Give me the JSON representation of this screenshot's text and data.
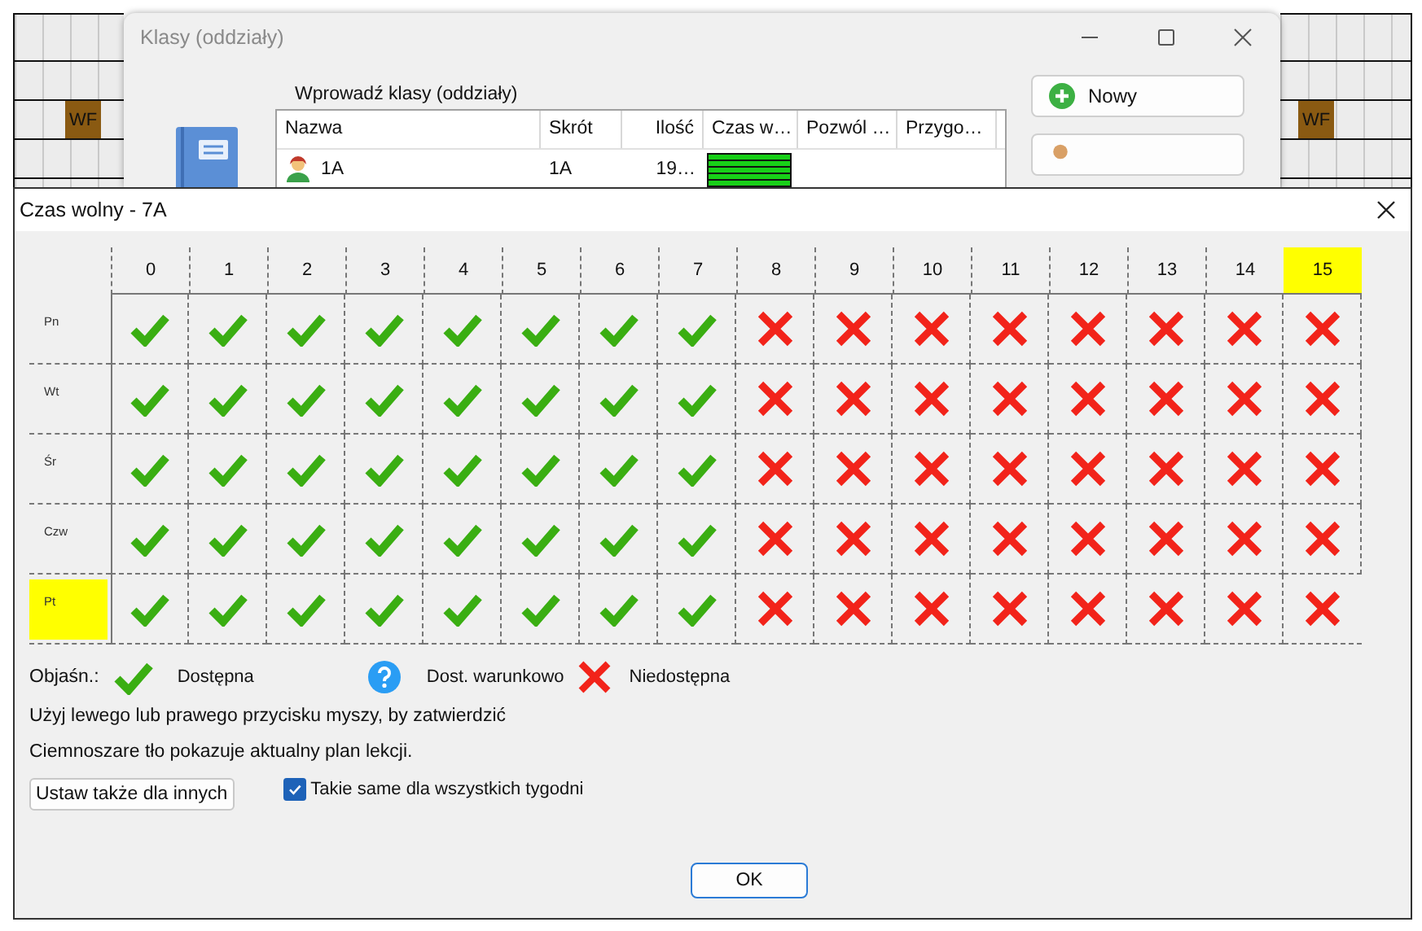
{
  "background_cells": [
    {
      "label": "WF"
    },
    {
      "label": "WF"
    }
  ],
  "class_window": {
    "title": "Klasy (oddziały)",
    "list_label": "Wprowadź klasy (oddziały)",
    "columns": [
      "Nazwa",
      "Skrót",
      "Ilość",
      "Czas w…",
      "Pozwól …",
      "Przygo…"
    ],
    "rows": [
      {
        "name": "1A",
        "short": "1A",
        "count": "19…"
      }
    ],
    "new_button": "Nowy"
  },
  "dialog": {
    "title": "Czas wolny - 7A",
    "hours": [
      {
        "label": "0",
        "selected": false
      },
      {
        "label": "1",
        "selected": false
      },
      {
        "label": "2",
        "selected": false
      },
      {
        "label": "3",
        "selected": false
      },
      {
        "label": "4",
        "selected": false
      },
      {
        "label": "5",
        "selected": false
      },
      {
        "label": "6",
        "selected": false
      },
      {
        "label": "7",
        "selected": false
      },
      {
        "label": "8",
        "selected": false
      },
      {
        "label": "9",
        "selected": false
      },
      {
        "label": "10",
        "selected": false
      },
      {
        "label": "11",
        "selected": false
      },
      {
        "label": "12",
        "selected": false
      },
      {
        "label": "13",
        "selected": false
      },
      {
        "label": "14",
        "selected": false
      },
      {
        "label": "15",
        "selected": true
      }
    ],
    "days": [
      {
        "label": "Pn",
        "selected": false,
        "slots": [
          {
            "kind": "available"
          },
          {
            "kind": "available"
          },
          {
            "kind": "available"
          },
          {
            "kind": "available"
          },
          {
            "kind": "available"
          },
          {
            "kind": "available"
          },
          {
            "kind": "available"
          },
          {
            "kind": "available"
          },
          {
            "kind": "unavailable"
          },
          {
            "kind": "unavailable"
          },
          {
            "kind": "unavailable"
          },
          {
            "kind": "unavailable"
          },
          {
            "kind": "unavailable"
          },
          {
            "kind": "unavailable"
          },
          {
            "kind": "unavailable"
          },
          {
            "kind": "unavailable"
          }
        ]
      },
      {
        "label": "Wt",
        "selected": false,
        "slots": [
          {
            "kind": "available"
          },
          {
            "kind": "available"
          },
          {
            "kind": "available"
          },
          {
            "kind": "available"
          },
          {
            "kind": "available"
          },
          {
            "kind": "available"
          },
          {
            "kind": "available"
          },
          {
            "kind": "available"
          },
          {
            "kind": "unavailable"
          },
          {
            "kind": "unavailable"
          },
          {
            "kind": "unavailable"
          },
          {
            "kind": "unavailable"
          },
          {
            "kind": "unavailable"
          },
          {
            "kind": "unavailable"
          },
          {
            "kind": "unavailable"
          },
          {
            "kind": "unavailable"
          }
        ]
      },
      {
        "label": "Śr",
        "selected": false,
        "slots": [
          {
            "kind": "available"
          },
          {
            "kind": "available"
          },
          {
            "kind": "available"
          },
          {
            "kind": "available"
          },
          {
            "kind": "available"
          },
          {
            "kind": "available"
          },
          {
            "kind": "available"
          },
          {
            "kind": "available"
          },
          {
            "kind": "unavailable"
          },
          {
            "kind": "unavailable"
          },
          {
            "kind": "unavailable"
          },
          {
            "kind": "unavailable"
          },
          {
            "kind": "unavailable"
          },
          {
            "kind": "unavailable"
          },
          {
            "kind": "unavailable"
          },
          {
            "kind": "unavailable"
          }
        ]
      },
      {
        "label": "Czw",
        "selected": false,
        "slots": [
          {
            "kind": "available"
          },
          {
            "kind": "available"
          },
          {
            "kind": "available"
          },
          {
            "kind": "available"
          },
          {
            "kind": "available"
          },
          {
            "kind": "available"
          },
          {
            "kind": "available"
          },
          {
            "kind": "available"
          },
          {
            "kind": "unavailable"
          },
          {
            "kind": "unavailable"
          },
          {
            "kind": "unavailable"
          },
          {
            "kind": "unavailable"
          },
          {
            "kind": "unavailable"
          },
          {
            "kind": "unavailable"
          },
          {
            "kind": "unavailable"
          },
          {
            "kind": "unavailable"
          }
        ]
      },
      {
        "label": "Pt",
        "selected": true,
        "slots": [
          {
            "kind": "available"
          },
          {
            "kind": "available"
          },
          {
            "kind": "available"
          },
          {
            "kind": "available"
          },
          {
            "kind": "available"
          },
          {
            "kind": "available"
          },
          {
            "kind": "available"
          },
          {
            "kind": "available"
          },
          {
            "kind": "unavailable"
          },
          {
            "kind": "unavailable"
          },
          {
            "kind": "unavailable"
          },
          {
            "kind": "unavailable"
          },
          {
            "kind": "unavailable"
          },
          {
            "kind": "unavailable"
          },
          {
            "kind": "unavailable"
          },
          {
            "kind": "unavailable"
          }
        ]
      }
    ],
    "legend": {
      "label": "Objaśn.:",
      "items": [
        {
          "kind": "available",
          "label": "Dostępna"
        },
        {
          "kind": "conditional",
          "label": "Dost. warunkowo"
        },
        {
          "kind": "unavailable",
          "label": "Niedostępna"
        }
      ]
    },
    "notes": [
      "Użyj lewego lub prawego przycisku myszy, by zatwierdzić",
      "Ciemnoszare tło pokazuje aktualny plan lekcji."
    ],
    "set_for_others_button": "Ustaw także dla innych",
    "same_all_weeks": {
      "label": "Takie same dla wszystkich tygodni",
      "checked": true
    },
    "ok_button": "OK"
  }
}
